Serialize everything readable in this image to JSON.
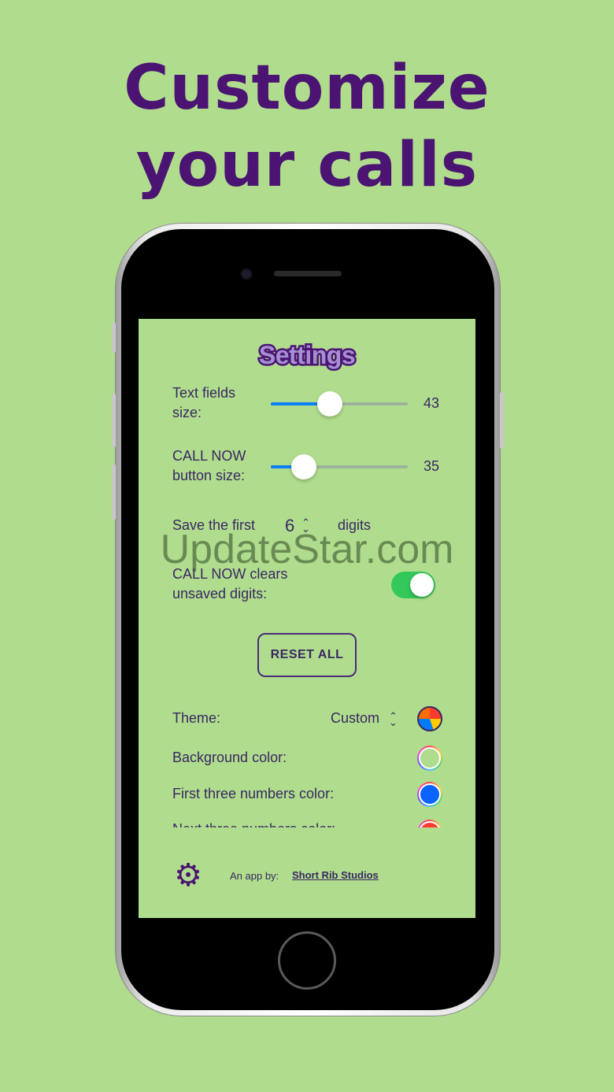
{
  "headline": {
    "line1": "Customize",
    "line2": "your calls"
  },
  "settings": {
    "title": "Settings",
    "text_fields_size": {
      "label_line1": "Text fields",
      "label_line2": "size:",
      "value": 43,
      "fraction": 0.43
    },
    "call_now_button_size": {
      "label_line1": "CALL NOW",
      "label_line2": "button size:",
      "value": 35,
      "fraction": 0.24
    },
    "save_digits": {
      "prefix": "Save the first",
      "value": "6",
      "suffix": "digits"
    },
    "clears_toggle": {
      "label_line1": "CALL NOW clears",
      "label_line2": "unsaved digits:",
      "on": true
    },
    "reset_label": "RESET ALL",
    "theme": {
      "label": "Theme:",
      "value": "Custom"
    },
    "background_color": {
      "label": "Background color:",
      "color": "#b0dd8d"
    },
    "first_three_color": {
      "label": "First three numbers color:",
      "color": "#0a64ff"
    },
    "next_three_color": {
      "label": "Next three numbers color:",
      "color": "#ff3b30"
    }
  },
  "footer": {
    "credit_prefix": "An app by:",
    "credit_link": "Short Rib Studios"
  },
  "watermark": "UpdateStar.com",
  "colors": {
    "background": "#b0dd8d",
    "brand_purple": "#4b1473",
    "toggle_on": "#34c759",
    "slider_fill": "#0a7ff5"
  },
  "icons": {
    "stepper": "chevron-up-down-icon",
    "settings": "gear-icon"
  }
}
